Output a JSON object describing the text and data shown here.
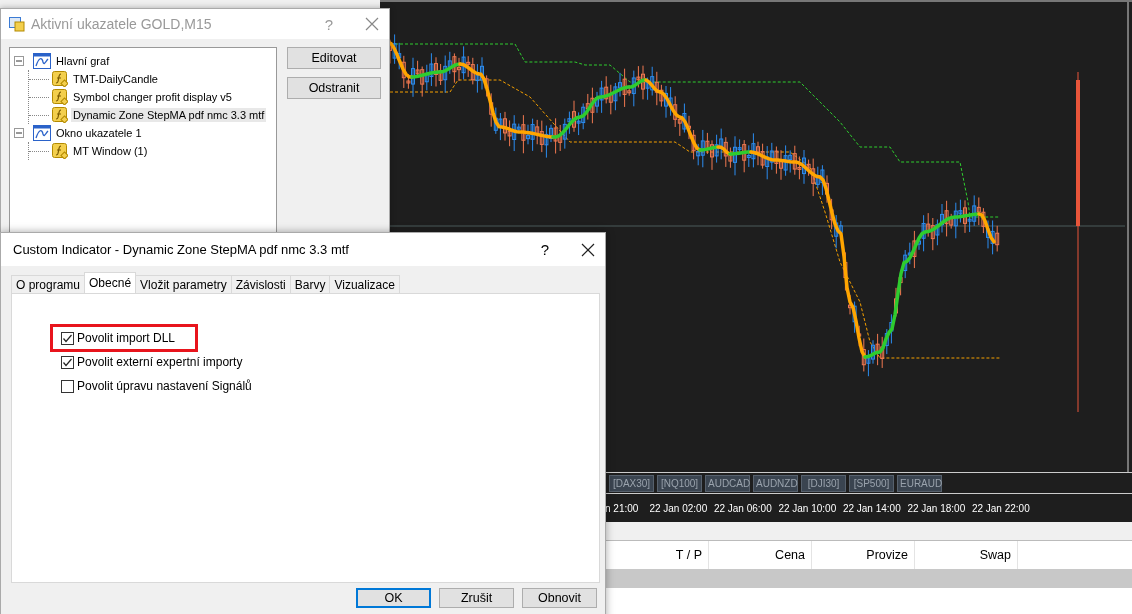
{
  "indicators_window": {
    "title": "Aktivní ukazatele GOLD,M15",
    "help": "?",
    "tree": [
      {
        "label": "Hlavní graf",
        "expanded": true,
        "selected": false,
        "children": [
          {
            "label": "TMT-DailyCandle",
            "selected": false
          },
          {
            "label": "Symbol changer profit display v5",
            "selected": false
          },
          {
            "label": "Dynamic Zone StepMA pdf nmc 3.3 mtf",
            "selected": true
          }
        ]
      },
      {
        "label": "Okno ukazatele 1",
        "expanded": true,
        "selected": false,
        "children": [
          {
            "label": "MT Window (1)",
            "selected": false
          }
        ]
      }
    ],
    "buttons": [
      "Editovat",
      "Odstranit"
    ]
  },
  "chart": {
    "symbol_buttons": [
      "[DAX30]",
      "[NQ100]",
      "AUDCAD",
      "AUDNZD",
      "[DJI30]",
      "[SP500]",
      "EURAUD"
    ],
    "time_labels": [
      "n 21:00",
      "22 Jan 02:00",
      "22 Jan 06:00",
      "22 Jan 10:00",
      "22 Jan 14:00",
      "22 Jan 18:00",
      "22 Jan 22:00"
    ]
  },
  "terminal": {
    "columns": [
      "T / P",
      "Cena",
      "Provize",
      "Swap"
    ]
  },
  "indicator_dialog": {
    "title": "Custom Indicator - Dynamic Zone StepMA pdf nmc 3.3 mtf",
    "help": "?",
    "tabs": [
      {
        "label": "O programu",
        "selected": false
      },
      {
        "label": "Obecné",
        "selected": true
      },
      {
        "label": "Vložit parametry",
        "selected": false
      },
      {
        "label": "Závislosti",
        "selected": false
      },
      {
        "label": "Barvy",
        "selected": false
      },
      {
        "label": "Vizualizace",
        "selected": false
      }
    ],
    "options": [
      {
        "label": "Povolit import DLL",
        "checked": true,
        "highlighted": true
      },
      {
        "label": "Povolit externí expertní importy",
        "checked": true,
        "highlighted": false
      },
      {
        "label": "Povolit úpravu nastavení Signálů",
        "checked": false,
        "highlighted": false
      }
    ],
    "buttons": [
      {
        "label": "OK",
        "default": true
      },
      {
        "label": "Zrušit",
        "default": false
      },
      {
        "label": "Obnovit",
        "default": false
      }
    ]
  }
}
